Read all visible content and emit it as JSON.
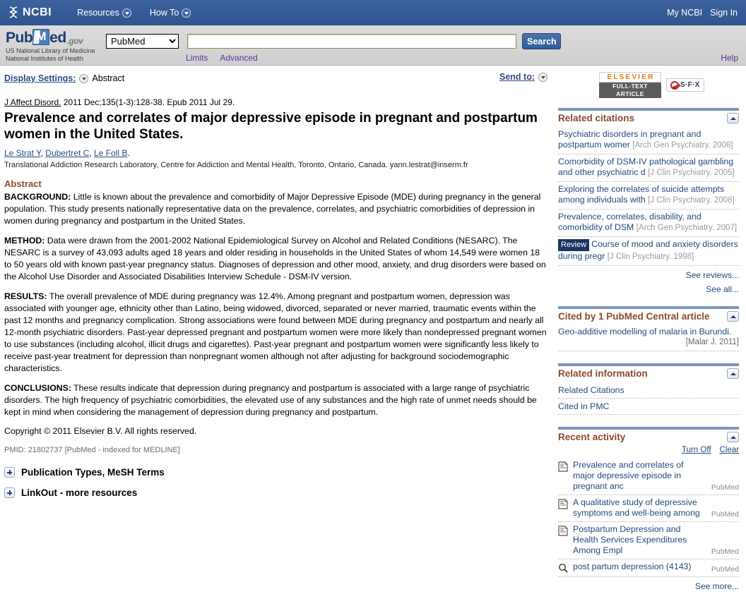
{
  "ncbi_bar": {
    "logo_text": "NCBI",
    "menu": [
      {
        "label": "Resources",
        "name": "resources"
      },
      {
        "label": "How To",
        "name": "how-to"
      }
    ],
    "my_ncbi": "My NCBI",
    "sign_in": "Sign In"
  },
  "pubmed_header": {
    "logo_pub": "Pub",
    "logo_m": "M",
    "logo_ed": "ed",
    "logo_gov": ".gov",
    "sub_line1": "US National Library of Medicine",
    "sub_line2": "National Institutes of Health",
    "db_selected": "PubMed",
    "db_options": [
      "PubMed"
    ],
    "search_value": "",
    "search_placeholder": "",
    "search_button": "Search",
    "limits": "Limits",
    "advanced": "Advanced",
    "help": "Help"
  },
  "toolbar": {
    "display_settings_label": "Display Settings:",
    "display_settings_value": "Abstract",
    "send_to_label": "Send to:"
  },
  "article": {
    "journal": "J Affect Disord.",
    "citation_rest": " 2011 Dec;135(1-3):128-38. Epub 2011 Jul 29.",
    "title": "Prevalence and correlates of major depressive episode in pregnant and postpartum women in the United States.",
    "authors": [
      "Le Strat Y",
      "Dubertret C",
      "Le Foll B"
    ],
    "affiliation": "Translational Addiction Research Laboratory, Centre for Addiction and Mental Health, Toronto, Ontario, Canada. yann.lestrat@inserm.fr",
    "abstract_heading": "Abstract",
    "sections": [
      {
        "label": "BACKGROUND:",
        "text": " Little is known about the prevalence and comorbidity of Major Depressive Episode (MDE) during pregnancy in the general population. This study presents nationally representative data on the prevalence, correlates, and psychiatric comorbidities of depression in women during pregnancy and postpartum in the United States."
      },
      {
        "label": "METHOD:",
        "text": " Data were drawn from the 2001-2002 National Epidemiological Survey on Alcohol and Related Conditions (NESARC). The NESARC is a survey of 43,093 adults aged 18 years and older residing in households in the United States of whom 14,549 were women 18 to 50 years old with known past-year pregnancy status. Diagnoses of depression and other mood, anxiety, and drug disorders were based on the Alcohol Use Disorder and Associated Disabilities Interview Schedule - DSM-IV version."
      },
      {
        "label": "RESULTS:",
        "text": " The overall prevalence of MDE during pregnancy was 12.4%. Among pregnant and postpartum women, depression was associated with younger age, ethnicity other than Latino, being widowed, divorced, separated or never married, traumatic events within the past 12 months and pregnancy complication. Strong associations were found between MDE during pregnancy and postpartum and nearly all 12-month psychiatric disorders. Past-year depressed pregnant and postpartum women were more likely than nondepressed pregnant women to use substances (including alcohol, illicit drugs and cigarettes). Past-year pregnant and postpartum women were significantly less likely to receive past-year treatment for depression than nonpregnant women although not after adjusting for background sociodemographic characteristics."
      },
      {
        "label": "CONCLUSIONS:",
        "text": " These results indicate that depression during pregnancy and postpartum is associated with a large range of psychiatric disorders. The high frequency of psychiatric comorbidities, the elevated use of any substances and the high rate of unmet needs should be kept in mind when considering the management of depression during pregnancy and postpartum."
      }
    ],
    "copyright": "Copyright © 2011 Elsevier B.V. All rights reserved.",
    "pmid": "PMID: 21802737 [PubMed - indexed for MEDLINE]"
  },
  "expandables": [
    {
      "label": "Publication Types, MeSH Terms",
      "name": "publication-types-mesh-terms"
    },
    {
      "label": "LinkOut - more resources",
      "name": "linkout-more-resources"
    }
  ],
  "publisher_links": {
    "elsevier_top": "ELSEVIER",
    "elsevier_bottom": "FULL-TEXT ARTICLE",
    "sfx_text": "S·F·X"
  },
  "related_citations": {
    "title": "Related citations",
    "items": [
      {
        "title": "Psychiatric disorders in pregnant and postpartum womer",
        "source": "[Arch Gen Psychiatry. 2008]",
        "badge": ""
      },
      {
        "title": "Comorbidity of DSM-IV pathological gambling and other psychiatric d",
        "source": "[J Clin Psychiatry. 2005]",
        "badge": ""
      },
      {
        "title": "Exploring the correlates of suicide attempts among individuals with",
        "source": "[J Clin Psychiatry. 2008]",
        "badge": ""
      },
      {
        "title": "Prevalence, correlates, disability, and comorbidity of DSM",
        "source": "[Arch Gen Psychiatry. 2007]",
        "badge": ""
      },
      {
        "title": "Course of mood and anxiety disorders during pregr",
        "source": "[J Clin Psychiatry. 1998]",
        "badge": "Review"
      }
    ],
    "see_reviews": "See reviews...",
    "see_all": "See all..."
  },
  "cited_by": {
    "title": "Cited by 1 PubMed Central article",
    "items": [
      {
        "title": "Geo-additive modelling of malaria in Burundi.",
        "source": "[Malar J. 2011]"
      }
    ]
  },
  "related_information": {
    "title": "Related information",
    "items": [
      {
        "label": "Related Citations"
      },
      {
        "label": "Cited in PMC"
      }
    ]
  },
  "recent_activity": {
    "title": "Recent activity",
    "turn_off": "Turn Off",
    "clear": "Clear",
    "items": [
      {
        "title": "Prevalence and correlates of major depressive episode in pregnant anc",
        "db": "PubMed",
        "icon": "document-icon"
      },
      {
        "title": "A qualitative study of depressive symptoms and well-being among",
        "db": "PubMed",
        "icon": "document-icon"
      },
      {
        "title": "Postpartum Depression and Health Services Expenditures Among Empl",
        "db": "PubMed",
        "icon": "document-icon"
      },
      {
        "title": "post partum depression (4143)",
        "db": "PubMed",
        "icon": "search-icon"
      }
    ],
    "see_more": "See more..."
  },
  "colors": {
    "ncbi_bar": "#36599a",
    "header_gray": "#d3d3d3",
    "link_blue": "#21497e",
    "panel_title_brown": "#8b4a2b",
    "purple_link": "#5a3696",
    "elsevier_orange": "#e8740c"
  }
}
